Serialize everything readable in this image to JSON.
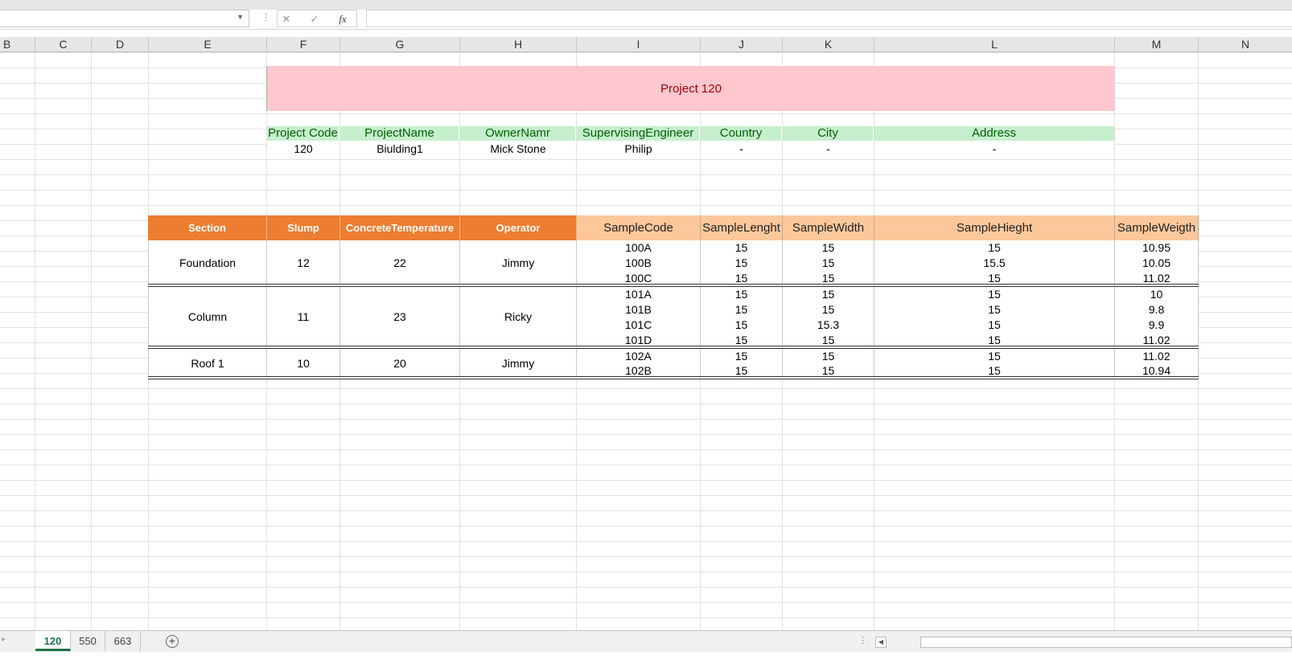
{
  "formula_bar": {
    "name_box": "",
    "cancel_icon": "✕",
    "enter_icon": "✓",
    "fx_label": "fx",
    "formula": ""
  },
  "columns": [
    "B",
    "C",
    "D",
    "E",
    "F",
    "G",
    "H",
    "I",
    "J",
    "K",
    "L",
    "M",
    "N"
  ],
  "project": {
    "title": "Project 120",
    "headers": [
      "Project Code",
      "ProjectName",
      "OwnerNamr",
      "SupervisingEngineer",
      "Country",
      "City",
      "Address"
    ],
    "values": [
      "120",
      "Biulding1",
      "Mick Stone",
      "Philip",
      "-",
      "-",
      "-"
    ]
  },
  "tests": {
    "section_headers": [
      "Section",
      "Slump",
      "ConcreteTemperature",
      "Operator"
    ],
    "sample_headers": [
      "SampleCode",
      "SampleLenght",
      "SampleWidth",
      "SampleHieght",
      "SampleWeigth"
    ],
    "groups": [
      {
        "section": "Foundation",
        "slump": "12",
        "temperature": "22",
        "operator": "Jimmy",
        "samples": [
          [
            "100A",
            "15",
            "15",
            "15",
            "10.95"
          ],
          [
            "100B",
            "15",
            "15",
            "15.5",
            "10.05"
          ],
          [
            "100C",
            "15",
            "15",
            "15",
            "11.02"
          ]
        ]
      },
      {
        "section": "Column",
        "slump": "11",
        "temperature": "23",
        "operator": "Ricky",
        "samples": [
          [
            "101A",
            "15",
            "15",
            "15",
            "10"
          ],
          [
            "101B",
            "15",
            "15",
            "15",
            "9.8"
          ],
          [
            "101C",
            "15",
            "15.3",
            "15",
            "9.9"
          ],
          [
            "101D",
            "15",
            "15",
            "15",
            "11.02"
          ]
        ]
      },
      {
        "section": "Roof 1",
        "slump": "10",
        "temperature": "20",
        "operator": "Jimmy",
        "samples": [
          [
            "102A",
            "15",
            "15",
            "15",
            "11.02"
          ],
          [
            "102B",
            "15",
            "15",
            "15",
            "10.94"
          ]
        ]
      }
    ]
  },
  "sheet_tabs": [
    {
      "label": "120",
      "active": true
    },
    {
      "label": "550",
      "active": false
    },
    {
      "label": "663",
      "active": false
    }
  ],
  "colors": {
    "title_fill": "#ffc7ce",
    "title_text": "#9c0006",
    "info_header_fill": "#c6efce",
    "info_header_text": "#006100",
    "section_header_fill": "#ed7d31",
    "sample_header_fill": "#fcc89b",
    "active_tab": "#217346"
  }
}
